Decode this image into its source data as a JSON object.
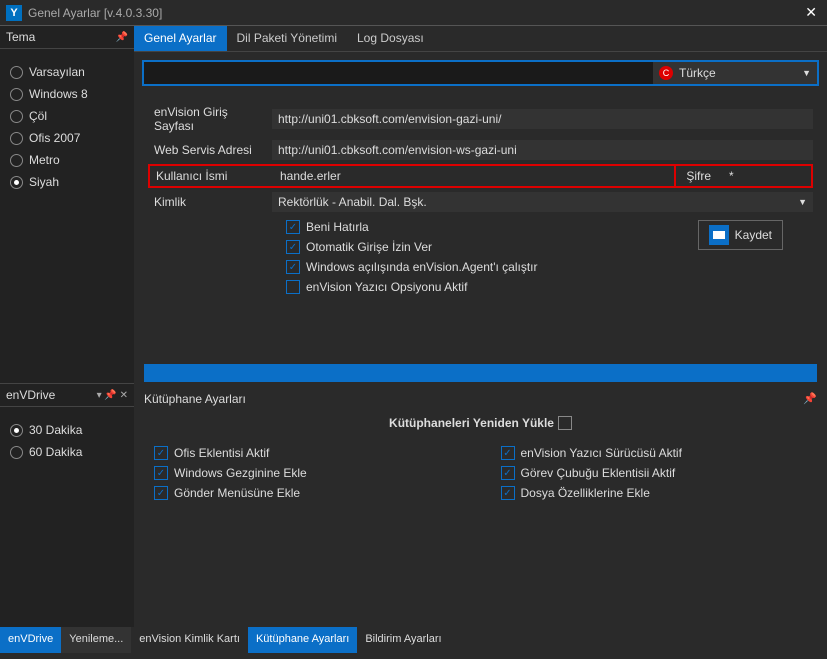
{
  "window": {
    "title": "Genel Ayarlar [v.4.0.3.30]"
  },
  "tabs_top": {
    "active": "Genel Ayarlar",
    "t1": "Dil Paketi Yönetimi",
    "t2": "Log Dosyası"
  },
  "language": {
    "selected": "Türkçe"
  },
  "theme": {
    "title": "Tema",
    "options": [
      "Varsayılan",
      "Windows 8",
      "Çöl",
      "Ofis 2007",
      "Metro",
      "Siyah"
    ],
    "selected": "Siyah"
  },
  "envdrive": {
    "title": "enVDrive",
    "options": [
      "30 Dakika",
      "60 Dakika"
    ],
    "selected": "30 Dakika"
  },
  "form": {
    "login_page_label": "enVision Giriş Sayfası",
    "login_page_value": "http://uni01.cbksoft.com/envision-gazi-uni/",
    "webservice_label": "Web Servis Adresi",
    "webservice_value": "http://uni01.cbksoft.com/envision-ws-gazi-uni",
    "username_label": "Kullanıcı İsmi",
    "username_value": "hande.erler",
    "password_label": "Şifre",
    "password_value": "*",
    "identity_label": "Kimlik",
    "identity_value": "Rektörlük - Anabil. Dal. Bşk."
  },
  "checks": {
    "remember": "Beni Hatırla",
    "autologin": "Otomatik Girişe İzin Ver",
    "winstart": "Windows açılışında enVision.Agent'ı çalıştır",
    "printer": "enVision Yazıcı Opsiyonu Aktif"
  },
  "save_label": "Kaydet",
  "library": {
    "section_title": "Kütüphane Ayarları",
    "reload_label": "Kütüphaneleri Yeniden Yükle",
    "left": [
      "Ofis Eklentisi Aktif",
      "Windows Gezginine Ekle",
      "Gönder Menüsüne Ekle"
    ],
    "right": [
      "enVision Yazıcı Sürücüsü Aktif",
      "Görev Çubuğu Eklentisii Aktif",
      "Dosya Özelliklerine Ekle"
    ]
  },
  "bottom_tabs": {
    "t0": "enVDrive",
    "t1": "Yenileme...",
    "t2": "enVision Kimlik Kartı",
    "t3": "Kütüphane Ayarları",
    "t4": "Bildirim Ayarları"
  }
}
